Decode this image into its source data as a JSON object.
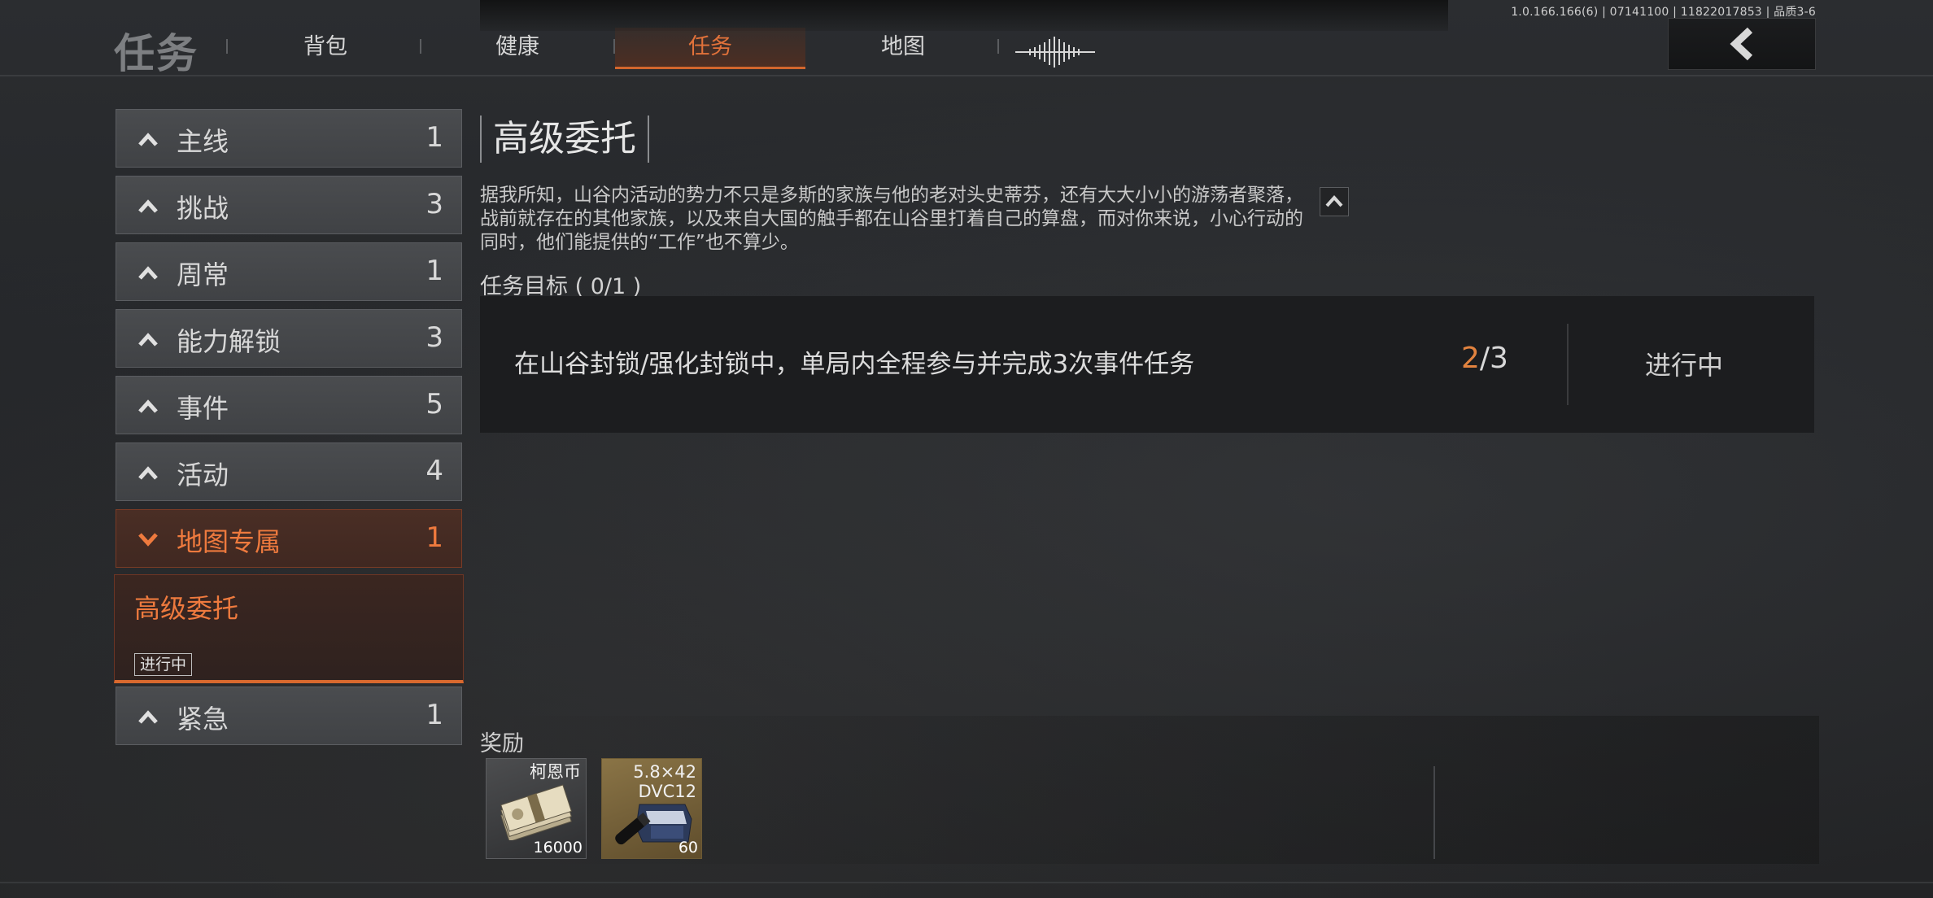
{
  "version_info": "1.0.166.166(6) | 07141100 | 11822017853 | 品质3-6",
  "header": {
    "title": "任务",
    "tabs": [
      {
        "label": "背包",
        "active": false
      },
      {
        "label": "健康",
        "active": false
      },
      {
        "label": "任务",
        "active": true
      },
      {
        "label": "地图",
        "active": false
      }
    ],
    "icons": {
      "sound": "sound-wave-icon",
      "back": "back-arrow-icon"
    }
  },
  "categories": [
    {
      "label": "主线",
      "count": "1",
      "expanded": false
    },
    {
      "label": "挑战",
      "count": "3",
      "expanded": false
    },
    {
      "label": "周常",
      "count": "1",
      "expanded": false
    },
    {
      "label": "能力解锁",
      "count": "3",
      "expanded": false
    },
    {
      "label": "事件",
      "count": "5",
      "expanded": false
    },
    {
      "label": "活动",
      "count": "4",
      "expanded": false
    },
    {
      "label": "地图专属",
      "count": "1",
      "expanded": true
    },
    {
      "label": "紧急",
      "count": "1",
      "expanded": false
    }
  ],
  "selected_task": {
    "name": "高级委托",
    "status": "进行中"
  },
  "quest": {
    "title": "高级委托",
    "description": "据我所知，山谷内活动的势力不只是多斯的家族与他的老对头史蒂芬，还有大大小小的游荡者聚落，战前就存在的其他家族，以及来自大国的触手都在山谷里打着自己的算盘，而对你来说，小心行动的同时，他们能提供的“工作”也不算少。",
    "objectives_header": "任务目标 ( 0/1 )",
    "objectives": [
      {
        "text": "在山谷封锁/强化封锁中，单局内全程参与并完成3次事件任务",
        "current": "2",
        "total": "/3",
        "status": "进行中"
      }
    ]
  },
  "rewards": {
    "label": "奖励",
    "items": [
      {
        "name": "柯恩币",
        "quantity": "16000",
        "icon": "cash-stack-icon"
      },
      {
        "name": "5.8×42\nDVC12",
        "quantity": "60",
        "icon": "ammo-box-icon"
      }
    ]
  },
  "colors": {
    "accent": "#e2723a",
    "progress": "#e2833f"
  }
}
